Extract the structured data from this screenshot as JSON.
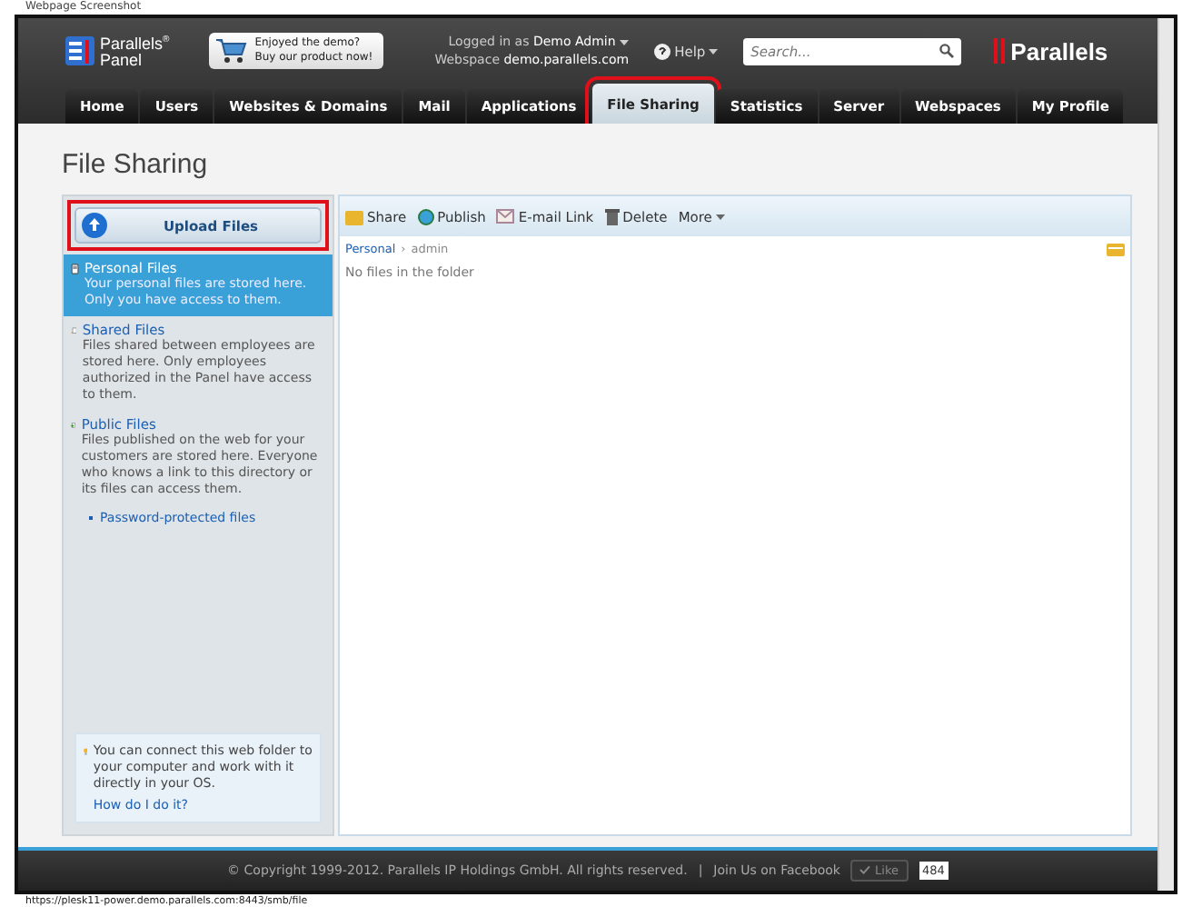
{
  "caption": "Webpage Screenshot",
  "header": {
    "logo_name": "Parallels$^{®}$",
    "logo_sub": "Panel",
    "promo": [
      "Enjoyed the demo?",
      "Buy our product now!"
    ],
    "login_label": "Logged in as",
    "user": "Demo Admin",
    "webspace_label": "Webspace",
    "webspace": "demo.parallels.com",
    "help": "Help",
    "search_placeholder": "Search...",
    "brand": "Parallels"
  },
  "tabs": [
    {
      "label": "Home",
      "selected": false,
      "highlighted": false
    },
    {
      "label": "Users",
      "selected": false,
      "highlighted": false
    },
    {
      "label": "Websites & Domains",
      "selected": false,
      "highlighted": false
    },
    {
      "label": "Mail",
      "selected": false,
      "highlighted": false
    },
    {
      "label": "Applications",
      "selected": false,
      "highlighted": false
    },
    {
      "label": "File Sharing",
      "selected": true,
      "highlighted": true
    },
    {
      "label": "Statistics",
      "selected": false,
      "highlighted": false
    },
    {
      "label": "Server",
      "selected": false,
      "highlighted": false
    },
    {
      "label": "Webspaces",
      "selected": false,
      "highlighted": false
    },
    {
      "label": "My Profile",
      "selected": false,
      "highlighted": false
    }
  ],
  "page_title": "File Sharing",
  "upload": {
    "label": "Upload Files",
    "highlighted": true
  },
  "sidebar": {
    "items": [
      {
        "title": "Personal Files",
        "text": "Your personal files are stored here. Only you have access to them.",
        "selected": true,
        "kind": "personal"
      },
      {
        "title": "Shared Files",
        "text": "Files shared between employees are stored here. Only employees authorized in the Panel have access to them.",
        "selected": false,
        "kind": "shared"
      },
      {
        "title": "Public Files",
        "text": "Files published on the web for your customers are stored here. Everyone who knows a link to this directory or its files can access them.",
        "selected": false,
        "kind": "public"
      }
    ],
    "sub_link": "Password-protected files",
    "tip": {
      "text": "You can connect this web folder to your computer and work with it directly in your OS.",
      "link": "How do I do it?"
    }
  },
  "toolbar": [
    {
      "label": "Share",
      "kind": "share"
    },
    {
      "label": "Publish",
      "kind": "publish"
    },
    {
      "label": "E-mail Link",
      "kind": "email"
    },
    {
      "label": "Delete",
      "kind": "delete"
    },
    {
      "label": "More",
      "kind": "more"
    }
  ],
  "breadcrumb": [
    "Personal",
    "admin"
  ],
  "breadcrumb_separator": "›",
  "empty_message": "No files in the folder",
  "footer": {
    "copyright": "© Copyright 1999-2012. Parallels IP Holdings GmbH. All rights reserved.",
    "separator": "|",
    "join": "Join Us on Facebook",
    "like": "Like",
    "like_count": "484"
  },
  "status_url": "https://plesk11-power.demo.parallels.com:8443/smb/file"
}
